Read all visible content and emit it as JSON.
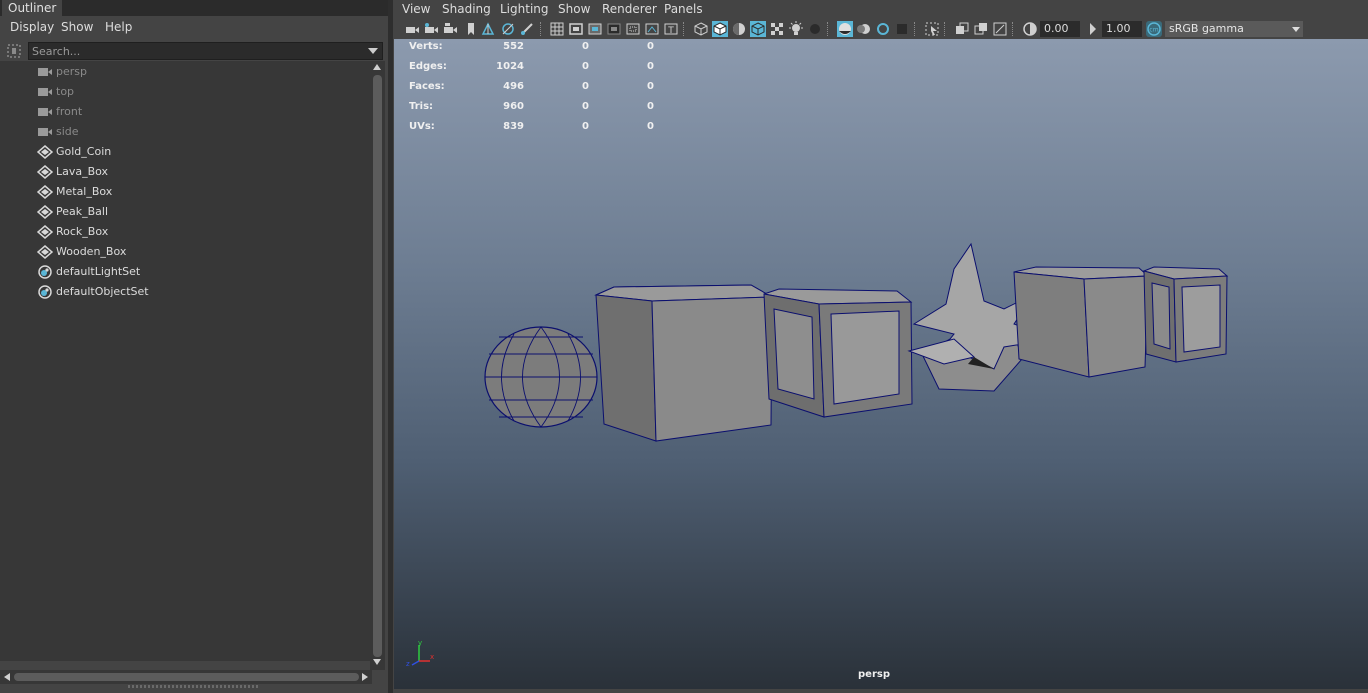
{
  "outliner": {
    "tab_title": "Outliner",
    "menu": [
      "Display",
      "Show",
      "Help"
    ],
    "search": {
      "placeholder": "Search..."
    },
    "items": [
      {
        "label": "persp",
        "type": "camera"
      },
      {
        "label": "top",
        "type": "camera"
      },
      {
        "label": "front",
        "type": "camera"
      },
      {
        "label": "side",
        "type": "camera"
      },
      {
        "label": "Gold_Coin",
        "type": "transform"
      },
      {
        "label": "Lava_Box",
        "type": "transform"
      },
      {
        "label": "Metal_Box",
        "type": "transform"
      },
      {
        "label": "Peak_Ball",
        "type": "transform"
      },
      {
        "label": "Rock_Box",
        "type": "transform"
      },
      {
        "label": "Wooden_Box",
        "type": "transform"
      },
      {
        "label": "defaultLightSet",
        "type": "set"
      },
      {
        "label": "defaultObjectSet",
        "type": "set"
      }
    ]
  },
  "viewport": {
    "menu": [
      "View",
      "Shading",
      "Lighting",
      "Show",
      "Renderer",
      "Panels"
    ],
    "exposure": "0.00",
    "gamma": "1.00",
    "color_space": "sRGB gamma",
    "camera_name": "persp",
    "hud": [
      {
        "label": "Verts:",
        "values": [
          "552",
          "0",
          "0"
        ]
      },
      {
        "label": "Edges:",
        "values": [
          "1024",
          "0",
          "0"
        ]
      },
      {
        "label": "Faces:",
        "values": [
          "496",
          "0",
          "0"
        ]
      },
      {
        "label": "Tris:",
        "values": [
          "960",
          "0",
          "0"
        ]
      },
      {
        "label": "UVs:",
        "values": [
          "839",
          "0",
          "0"
        ]
      }
    ],
    "axis_labels": {
      "x": "x",
      "y": "y",
      "z": "z"
    }
  },
  "colors": {
    "panel_bg": "#444444",
    "field_bg": "#2b2b2b",
    "accent_blue": "#5ab6d6",
    "wire_blue": "#0b0f6e",
    "mesh_grey": "#8a8a8a"
  }
}
